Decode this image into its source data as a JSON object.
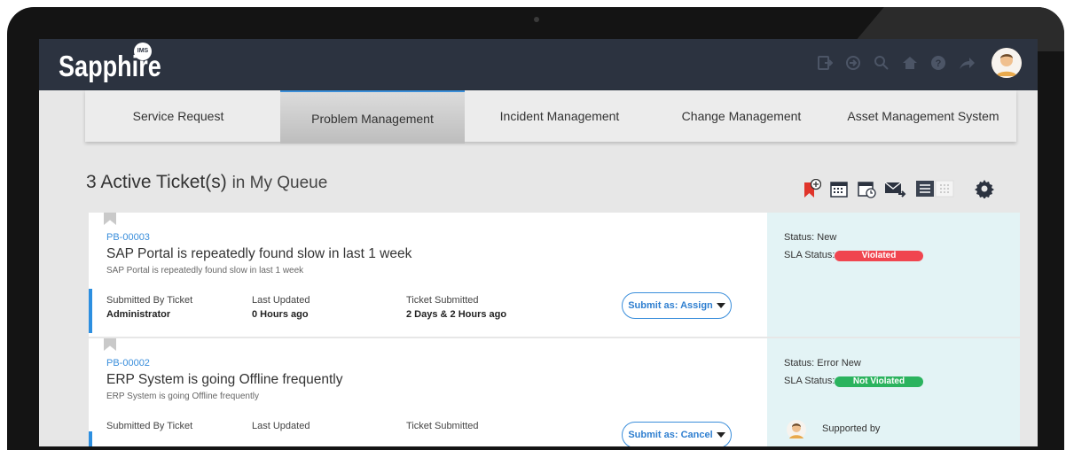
{
  "app": {
    "logo_text": "Sapphire",
    "logo_badge": "IMS"
  },
  "toolbar_icons": [
    "logout-icon",
    "login-icon",
    "search-icon",
    "home-icon",
    "help-icon",
    "forward-icon",
    "user-avatar"
  ],
  "tabs": [
    {
      "label": "Service Request",
      "active": false
    },
    {
      "label": "Problem Management",
      "active": true
    },
    {
      "label": "Incident Management",
      "active": false
    },
    {
      "label": "Change Management",
      "active": false
    },
    {
      "label": "Asset Management System",
      "active": false
    }
  ],
  "queue": {
    "title": "3 Active Ticket(s)",
    "subtitle": "in My Queue"
  },
  "queue_tools": [
    "add-bookmark-icon",
    "calendar-icon",
    "schedule-icon",
    "mail-forward-icon",
    "list-view-icon",
    "grid-view-icon",
    "settings-icon"
  ],
  "tickets": [
    {
      "id": "PB-00003",
      "title": "SAP Portal is repeatedly found slow in last 1 week",
      "description": "SAP Portal is repeatedly found slow in last 1 week",
      "submitted_by_label": "Submitted By Ticket",
      "submitted_by": "Administrator",
      "last_updated_label": "Last Updated",
      "last_updated": "0 Hours ago",
      "ticket_submitted_label": "Ticket Submitted",
      "ticket_submitted": "2 Days & 2 Hours ago",
      "submit_label": "Submit as: Assign",
      "status": "Status: New",
      "sla_label": "SLA Status:",
      "sla_value": "Violated",
      "sla_color": "#f0454f"
    },
    {
      "id": "PB-00002",
      "title": "ERP System is going Offline frequently",
      "description": "ERP System is going Offline frequently",
      "submitted_by_label": "Submitted By Ticket",
      "last_updated_label": "Last Updated",
      "ticket_submitted_label": "Ticket Submitted",
      "submit_label": "Submit as: Cancel",
      "status": "Status: Error New",
      "sla_label": "SLA Status:",
      "sla_value": "Not Violated",
      "sla_color": "#2bb35e",
      "supported_by_label": "Supported by"
    }
  ],
  "colors": {
    "topbar": "#2c3340",
    "accent_blue": "#3a8edb",
    "panel": "#e3f3f5"
  }
}
